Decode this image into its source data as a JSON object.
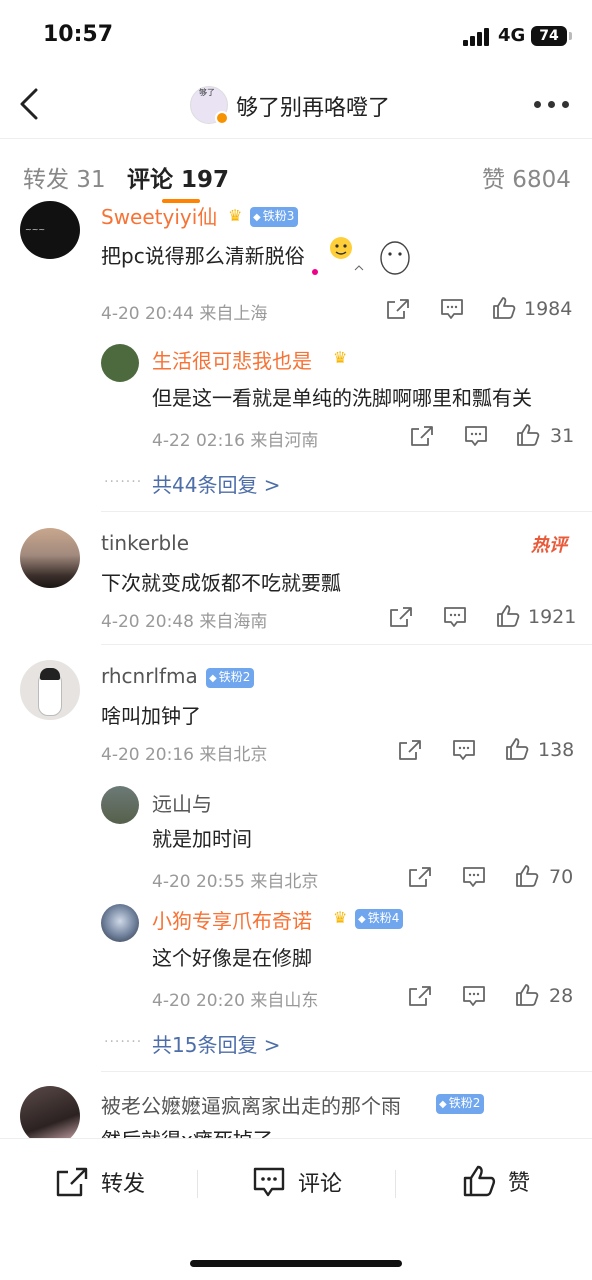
{
  "status": {
    "time": "10:57",
    "network": "4G",
    "battery": "74"
  },
  "header": {
    "title": "够了别再咯噔了",
    "avatar_caption": "够了"
  },
  "tabs": [
    {
      "label": "转发 31"
    },
    {
      "label": "评论 197"
    },
    {
      "label": "赞 6804"
    }
  ],
  "comments": [
    {
      "name": "Sweetyiyi仙",
      "badge": "铁粉3",
      "text": "把pc说得那么清新脱俗",
      "time": "4-20 20:44",
      "location": "来自上海",
      "likes": "1984",
      "replies": [
        {
          "name": "生活很可悲我也是",
          "text": "但是这一看就是单纯的洗脚啊哪里和瓢有关",
          "time": "4-22 02:16",
          "location": "来自河南",
          "likes": "31"
        }
      ],
      "more_replies": "共44条回复 >"
    },
    {
      "name": "tinkerble",
      "hot_label": "热评",
      "text": "下次就变成饭都不吃就要瓢",
      "time": "4-20 20:48",
      "location": "来自海南",
      "likes": "1921"
    },
    {
      "name": "rhcnrlfma",
      "badge": "铁粉2",
      "text": "啥叫加钟了",
      "time": "4-20 20:16",
      "location": "来自北京",
      "likes": "138",
      "replies": [
        {
          "name": "远山与",
          "text": "就是加时间",
          "time": "4-20 20:55",
          "location": "来自北京",
          "likes": "70"
        },
        {
          "name": "小狗专享爪布奇诺",
          "badge": "铁粉4",
          "text": "这个好像是在修脚",
          "time": "4-20 20:20",
          "location": "来自山东",
          "likes": "28"
        }
      ],
      "more_replies": "共15条回复 >"
    },
    {
      "name": "被老公嬷嬷逼疯离家出走的那个雨",
      "badge": "铁粉2",
      "text": "然后就得x瘫死掉了"
    }
  ],
  "bottom_bar": {
    "repost": "转发",
    "comment": "评论",
    "like": "赞"
  },
  "colors": {
    "accent": "#ff8200",
    "vip_name": "#f77234",
    "link": "#4d6ea8",
    "badge": "#6fa6ee"
  },
  "icons": [
    "back-arrow-icon",
    "more-icon",
    "share-icon",
    "comment-icon",
    "like-icon",
    "crown-icon"
  ]
}
